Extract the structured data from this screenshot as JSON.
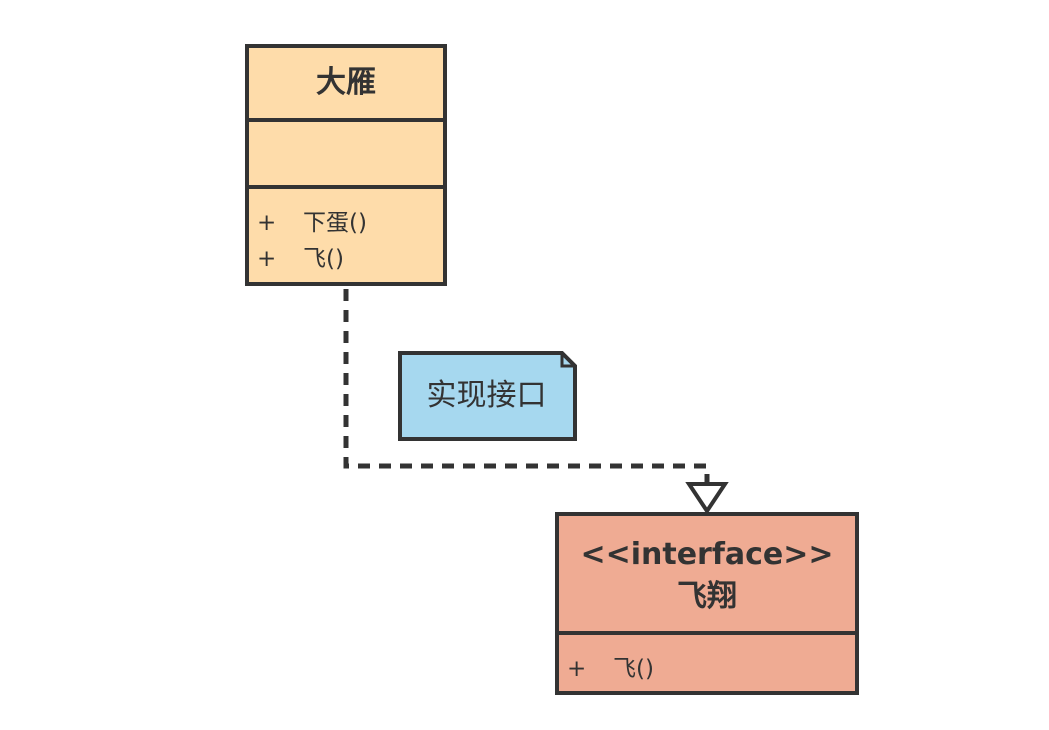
{
  "class_box": {
    "name": "大雁",
    "attributes": [],
    "operations": [
      {
        "visibility": "+",
        "name": "下蛋()"
      },
      {
        "visibility": "+",
        "name": "飞()"
      }
    ],
    "fill_color": "#fedcaa"
  },
  "interface_box": {
    "stereotype": "<<interface>>",
    "name": "飞翔",
    "operations": [
      {
        "visibility": "+",
        "name": "飞()"
      }
    ],
    "fill_color": "#efab93"
  },
  "note": {
    "text": "实现接口",
    "fill_color": "#a6d8ef"
  },
  "relationship": {
    "type": "realization",
    "from": "大雁",
    "to": "飞翔",
    "line_style": "dashed",
    "arrowhead": "hollow-triangle"
  },
  "stroke_color": "#333333"
}
